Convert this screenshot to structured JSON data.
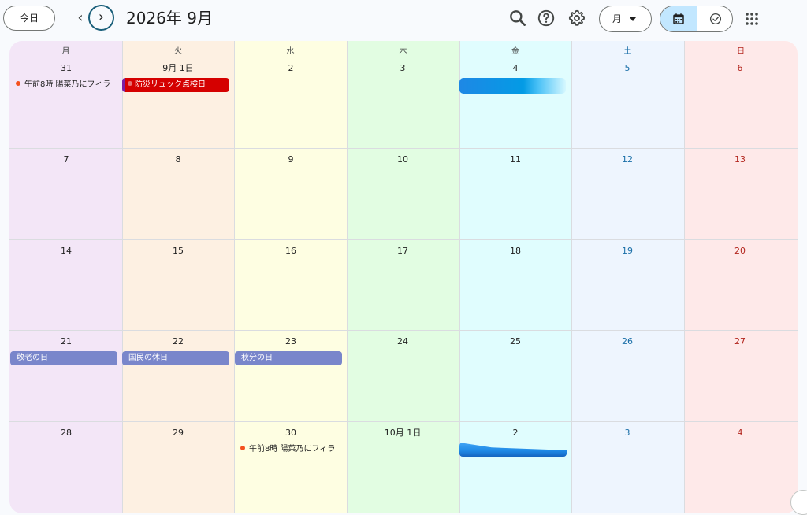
{
  "header": {
    "today_label": "今日",
    "prev_label": "‹",
    "next_label": "›",
    "title": "2026年 9月",
    "view_label": "月"
  },
  "colors": {
    "col_bg": [
      "#f3e6f7",
      "#fdf0e2",
      "#fefee2",
      "#e2fde2",
      "#e0fdfe",
      "#eef5fe",
      "#fee9e9"
    ],
    "holiday": "#7986cb",
    "red_event": "#d50000",
    "dot": "#f4511e",
    "accent": "#0b57d0"
  },
  "weekdays": [
    "月",
    "火",
    "水",
    "木",
    "金",
    "土",
    "日"
  ],
  "weeks": [
    [
      "31",
      "9月 1日",
      "2",
      "3",
      "4",
      "5",
      "6"
    ],
    [
      "7",
      "8",
      "9",
      "10",
      "11",
      "12",
      "13"
    ],
    [
      "14",
      "15",
      "16",
      "17",
      "18",
      "19",
      "20"
    ],
    [
      "21",
      "22",
      "23",
      "24",
      "25",
      "26",
      "27"
    ],
    [
      "28",
      "29",
      "30",
      "10月 1日",
      "2",
      "3",
      "4"
    ]
  ],
  "events": {
    "aug31": "午前8時 陽菜乃にフィラ",
    "sep1": "防災リュック点検日",
    "sep21": "敬老の日",
    "sep22": "国民の休日",
    "sep23": "秋分の日",
    "sep30": "午前8時 陽菜乃にフィラ"
  }
}
